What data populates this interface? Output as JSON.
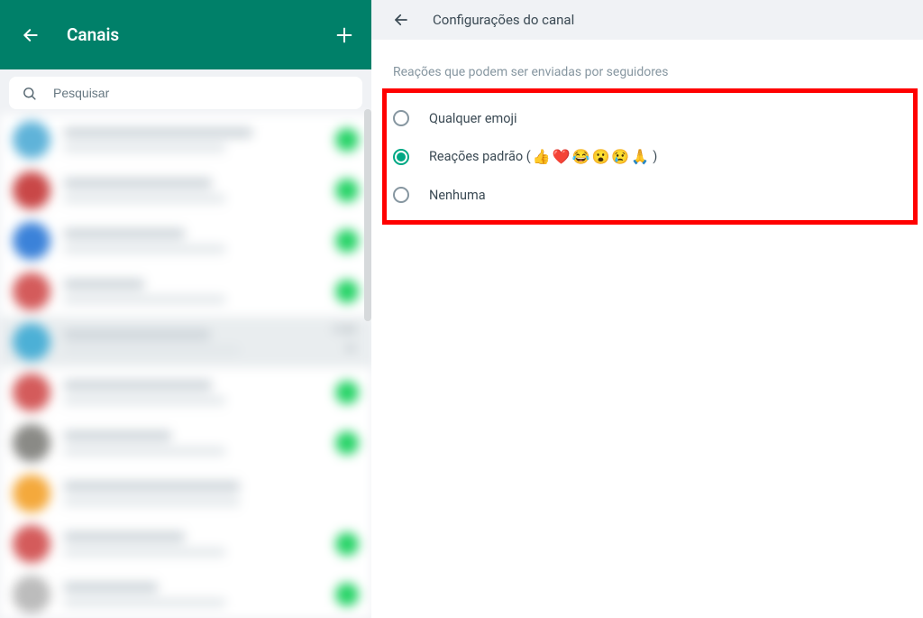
{
  "sidebar": {
    "title": "Canais",
    "search_placeholder": "Pesquisar",
    "channels": [
      {
        "avatar_color": "#5fb3d9",
        "title_w": "70%",
        "has_dot": true
      },
      {
        "avatar_color": "#c94747",
        "title_w": "55%",
        "has_dot": true
      },
      {
        "avatar_color": "#3b82d9",
        "title_w": "45%",
        "has_dot": true
      },
      {
        "avatar_color": "#d45b5b",
        "title_w": "30%",
        "has_dot": true
      },
      {
        "avatar_color": "#4cb0d6",
        "title_w": "50%",
        "has_dot": false,
        "time": "11:01",
        "selected": true,
        "chevron": true
      },
      {
        "avatar_color": "#d45b5b",
        "title_w": "55%",
        "has_dot": true
      },
      {
        "avatar_color": "#8a8a86",
        "title_w": "40%",
        "has_dot": true
      },
      {
        "avatar_color": "#f4a93c",
        "title_w": "60%",
        "has_dot": false
      },
      {
        "avatar_color": "#d45b5b",
        "title_w": "45%",
        "has_dot": true
      },
      {
        "avatar_color": "#bcbcbc",
        "title_w": "35%",
        "has_dot": true
      }
    ]
  },
  "main": {
    "header_title": "Configurações do canal",
    "section_label": "Reações que podem ser enviadas por seguidores",
    "options": [
      {
        "label": "Qualquer emoji",
        "checked": false
      },
      {
        "label_pre": "Reações padrão (",
        "emojis": "👍❤️😂😮😢🙏",
        "label_post": ")",
        "checked": true
      },
      {
        "label": "Nenhuma",
        "checked": false
      }
    ]
  }
}
